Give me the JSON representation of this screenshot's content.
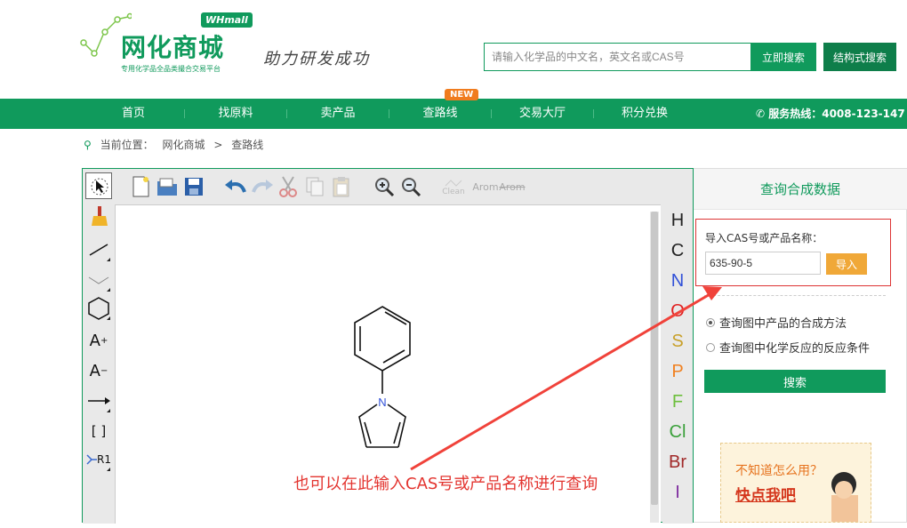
{
  "header": {
    "logo_name": "网化商城",
    "logo_badge": "WHmall",
    "logo_sub": "专用化学品全品类撮合交易平台",
    "slogan": "助力研发成功",
    "search_placeholder": "请输入化学品的中文名，英文名或CAS号",
    "search_button": "立即搜索",
    "structure_button": "结构式搜索"
  },
  "nav": {
    "items": [
      "首页",
      "找原料",
      "卖产品",
      "查路线",
      "交易大厅",
      "积分兑换"
    ],
    "new_badge": "NEW",
    "hotline": "服务热线：4008-123-147"
  },
  "breadcrumb": {
    "prefix": "当前位置：",
    "items": [
      "网化商城",
      "查路线"
    ],
    "separator": ">"
  },
  "editor": {
    "toolbar_text": {
      "clean": "Clean",
      "arom": "Arom",
      "arom_strike": "Arom"
    },
    "left_tools": {
      "charge_plus": "A",
      "charge_minus": "A",
      "brackets": "[ ]",
      "rgroup": "R1"
    },
    "atoms": [
      {
        "symbol": "H",
        "color": "#222222"
      },
      {
        "symbol": "C",
        "color": "#222222"
      },
      {
        "symbol": "N",
        "color": "#3050d8"
      },
      {
        "symbol": "O",
        "color": "#e02020"
      },
      {
        "symbol": "S",
        "color": "#c8a02a"
      },
      {
        "symbol": "P",
        "color": "#f08020"
      },
      {
        "symbol": "F",
        "color": "#6cbf3c"
      },
      {
        "symbol": "Cl",
        "color": "#3aa03a"
      },
      {
        "symbol": "Br",
        "color": "#a02828"
      },
      {
        "symbol": "I",
        "color": "#8030a0"
      }
    ],
    "molecule_label": "N"
  },
  "panel": {
    "title": "查询合成数据",
    "import_label": "导入CAS号或产品名称：",
    "cas_value": "635-90-5",
    "import_button": "导入",
    "option1": "查询图中产品的合成方法",
    "option2": "查询图中化学反应的反应条件",
    "search_button": "搜索",
    "help_question": "不知道怎么用？",
    "help_link": "快点我吧"
  },
  "annotation": "也可以在此输入CAS号或产品名称进行查询"
}
